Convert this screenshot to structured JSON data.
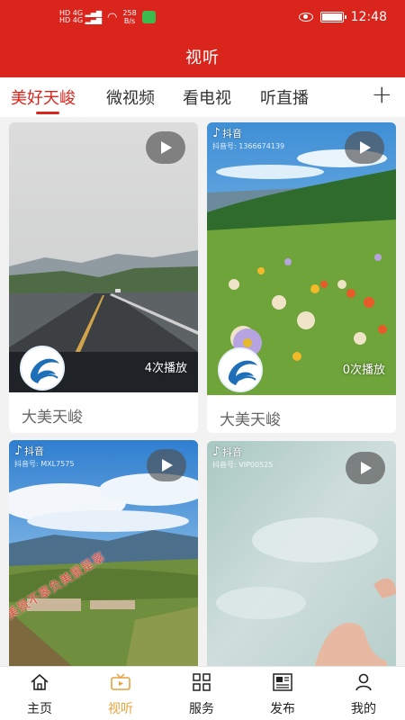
{
  "status_bar": {
    "network_labels": [
      "HD",
      "4G",
      "HD",
      "4G"
    ],
    "speed": "258",
    "speed_unit": "B/s",
    "time": "12:48"
  },
  "page_title": "视听",
  "tabs": [
    {
      "label": "美好天峻",
      "active": true
    },
    {
      "label": "微视频",
      "active": false
    },
    {
      "label": "看电视",
      "active": false
    },
    {
      "label": "听直播",
      "active": false
    }
  ],
  "add_icon": "plus-icon",
  "cards": [
    {
      "title": "大美天峻",
      "plays": "4次播放"
    },
    {
      "title": "大美天峻",
      "plays": "0次播放",
      "tiktok_label": "抖音",
      "tiktok_id": "抖音号: 1366674139"
    },
    {
      "tiktok_label": "抖音",
      "tiktok_id": "抖音号: MXL7575",
      "overlay_text": "美景不辜负美景是辜"
    },
    {
      "tiktok_label": "抖音",
      "tiktok_id": "抖音号: VIP00525"
    }
  ],
  "bottom_nav": [
    {
      "label": "主页",
      "icon": "home-icon",
      "active": false
    },
    {
      "label": "视听",
      "icon": "tv-icon",
      "active": true
    },
    {
      "label": "服务",
      "icon": "grid-icon",
      "active": false
    },
    {
      "label": "发布",
      "icon": "newspaper-icon",
      "active": false
    },
    {
      "label": "我的",
      "icon": "person-icon",
      "active": false
    }
  ],
  "colors": {
    "brand_red": "#d9251c",
    "nav_active": "#e6a23c"
  }
}
